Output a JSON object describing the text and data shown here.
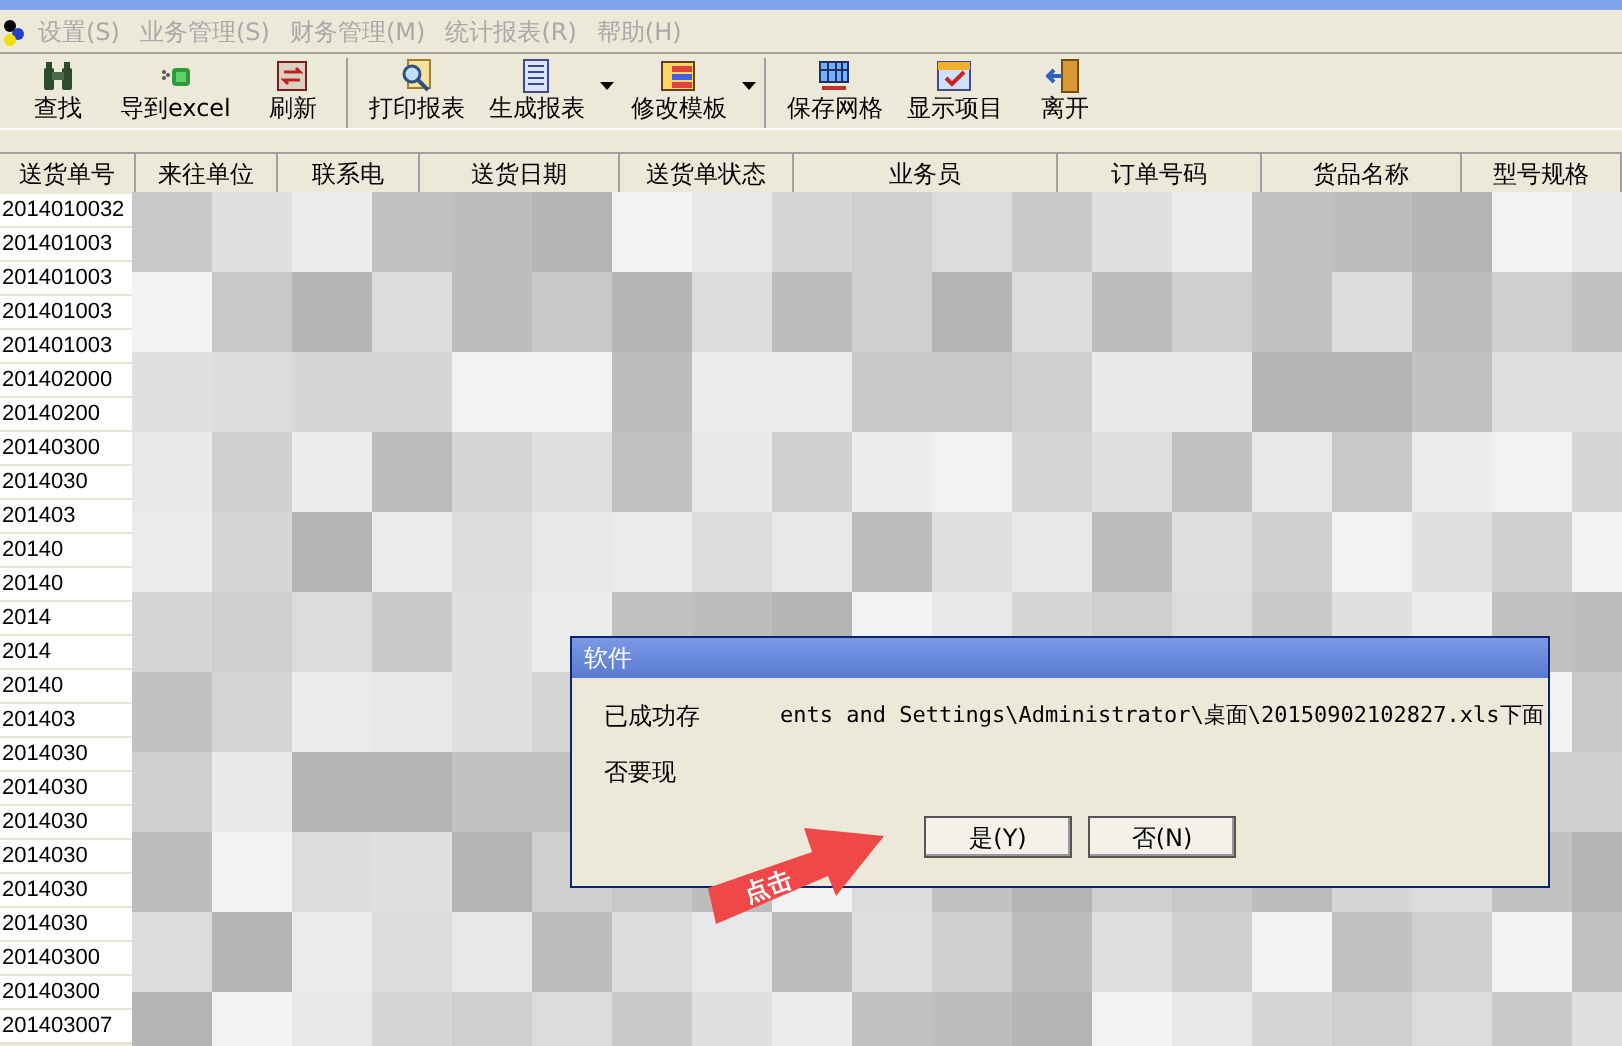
{
  "menu": [
    {
      "label": "设置(S)",
      "disabled": true
    },
    {
      "label": "业务管理(S)",
      "disabled": true
    },
    {
      "label": "财务管理(M)",
      "disabled": true
    },
    {
      "label": "统计报表(R)",
      "disabled": true
    },
    {
      "label": "帮助(H)",
      "disabled": true
    }
  ],
  "toolbar": [
    [
      {
        "label": "查找",
        "dropdown": false
      },
      {
        "label": "导到excel",
        "dropdown": false
      },
      {
        "label": "刷新",
        "dropdown": false
      }
    ],
    [
      {
        "label": "打印报表",
        "dropdown": false
      },
      {
        "label": "生成报表",
        "dropdown": true
      },
      {
        "label": "修改模板",
        "dropdown": true
      }
    ],
    [
      {
        "label": "保存网格",
        "dropdown": false
      },
      {
        "label": "显示项目",
        "dropdown": false
      },
      {
        "label": "离开",
        "dropdown": false
      }
    ]
  ],
  "table": {
    "columns": [
      "送货单号",
      "来往单位",
      "联系电",
      "送货日期",
      "送货单状态",
      "业务员",
      "订单号码",
      "货品名称",
      "型号规格"
    ],
    "rows": [
      "2014010032",
      "201401003",
      "201401003",
      "201401003",
      "201401003",
      "201402000",
      "20140200",
      "20140300",
      "2014030",
      "201403",
      "20140",
      "20140",
      "2014",
      "2014",
      "20140",
      "201403",
      "2014030",
      "2014030",
      "2014030",
      "2014030",
      "2014030",
      "2014030",
      "20140300",
      "20140300",
      "201403007"
    ]
  },
  "dialog": {
    "title": "软件",
    "message_parts": [
      "已成功存",
      "ents and Settings\\Administrator\\桌面\\20150902102827.xls下面"
    ],
    "question": "否要现",
    "buttons": [
      "是(Y)",
      "否(N)"
    ]
  },
  "annotation": {
    "text": "点击"
  }
}
